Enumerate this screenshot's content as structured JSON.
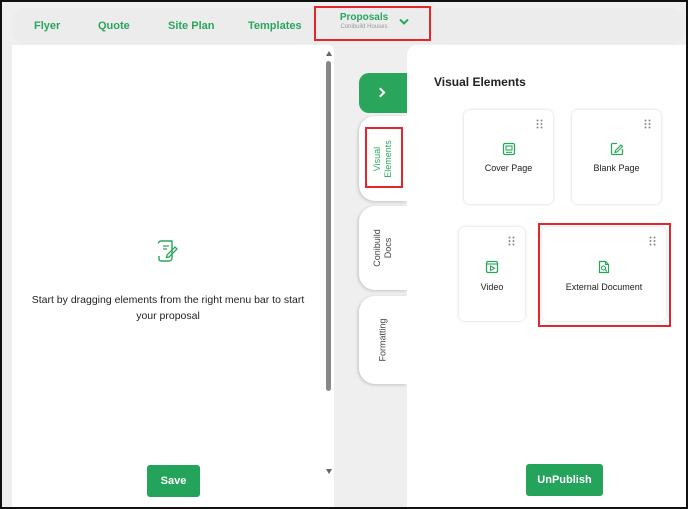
{
  "nav": {
    "items": [
      "Flyer",
      "Quote",
      "Site Plan",
      "Templates"
    ],
    "active": {
      "label": "Proposals",
      "sublabel": "Conibuild Houses"
    }
  },
  "canvas": {
    "empty_message": "Start by dragging elements from the right menu bar to start your proposal",
    "save_label": "Save"
  },
  "side_tabs": [
    {
      "label": "Visual Elements",
      "active": true
    },
    {
      "label": "Conibuild Docs",
      "active": false
    },
    {
      "label": "Formatting",
      "active": false
    }
  ],
  "visual_elements": {
    "title": "Visual Elements",
    "cards": [
      {
        "label": "Cover Page",
        "icon": "cover-page-icon"
      },
      {
        "label": "Blank Page",
        "icon": "blank-page-edit-icon"
      },
      {
        "label": "Video",
        "icon": "video-icon"
      },
      {
        "label": "External Document",
        "icon": "external-document-icon"
      }
    ]
  },
  "unpublish_label": "UnPublish",
  "colors": {
    "accent": "#2aa65c",
    "highlight": "#e1262d"
  }
}
